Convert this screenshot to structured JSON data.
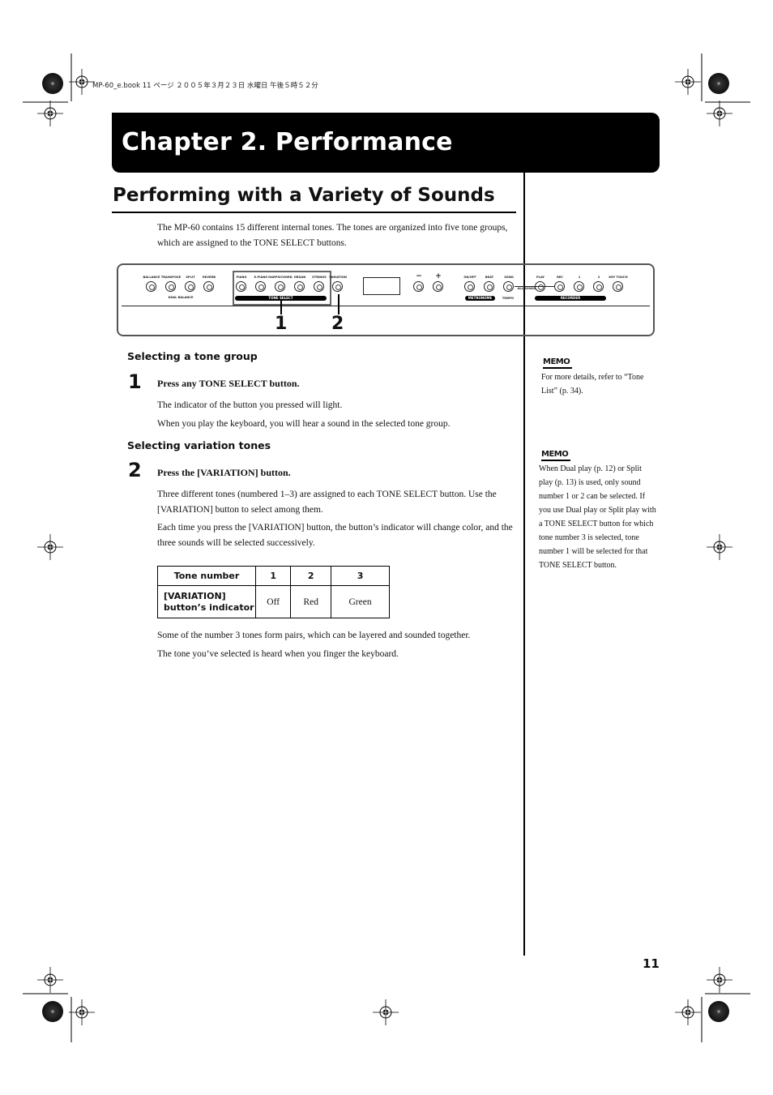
{
  "print_header": "MP-60_e.book  11 ページ  ２００５年３月２３日  水曜日  午後５時５２分",
  "chapter_title": "Chapter 2. Performance",
  "section_title": "Performing with a Variety of Sounds",
  "intro": "The MP-60 contains 15 different internal tones. The tones are organized into five tone groups, which are assigned to the TONE SELECT buttons.",
  "panel": {
    "buttons": [
      "BALLANCE",
      "TRANSPOSE",
      "SPLIT",
      "REVERB",
      "PIANO",
      "E.PIANO",
      "HARPSICHORD",
      "ORGAN",
      "STRINGS",
      "VARIATION",
      "−",
      "+",
      "ON/OFF",
      "BEAT",
      "SONG",
      "PLAY",
      "REC",
      "1",
      "2",
      "KEY TOUCH"
    ],
    "group_labels": {
      "dual_balance": "DUAL BALANCE",
      "tone_select": "TONE SELECT",
      "metronome": "METRONOME",
      "tempo": "TEMPO",
      "all_songs": "ALL SONGS",
      "recorder": "RECORDER"
    },
    "callouts": [
      "1",
      "2"
    ]
  },
  "steps": [
    {
      "heading": "Selecting a tone group",
      "number": "1",
      "instruction": "Press any TONE SELECT button.",
      "paragraphs": [
        "The indicator of the button you pressed will light.",
        "When you play the keyboard, you will hear a sound in the selected tone group."
      ]
    },
    {
      "heading": "Selecting variation tones",
      "number": "2",
      "instruction": "Press the [VARIATION] button.",
      "paragraphs": [
        "Three different tones (numbered 1–3) are assigned to each TONE SELECT button. Use the [VARIATION] button to select among them.",
        "Each time you press the [VARIATION] button, the button’s indicator will change color, and the three sounds will be selected successively."
      ]
    }
  ],
  "table": {
    "header": [
      "Tone number",
      "1",
      "2",
      "3"
    ],
    "row_label": "[VARIATION] button’s indicator",
    "row": [
      "Off",
      "Red",
      "Green"
    ]
  },
  "after_table": [
    "Some of the number 3 tones form pairs, which can be layered and sounded together.",
    "The tone you’ve selected is heard when you finger the keyboard."
  ],
  "memos": [
    {
      "badge": "MEMO",
      "text": "For more details, refer to “Tone List” (p. 34)."
    },
    {
      "badge": "MEMO",
      "text": "When Dual play (p. 12) or Split play (p. 13) is used, only sound number 1 or 2 can be selected. If you use Dual play or Split play with a TONE SELECT button for which tone number 3 is selected, tone number 1 will be selected for that TONE SELECT button."
    }
  ],
  "page_number": "11"
}
